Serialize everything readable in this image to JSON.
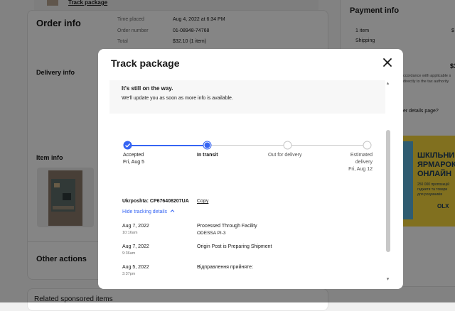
{
  "background": {
    "track_package_link": "Track package",
    "order_info": {
      "heading": "Order info",
      "rows": [
        {
          "label": "Time placed",
          "value": "Aug 4, 2022 at 6:34 PM"
        },
        {
          "label": "Order number",
          "value": "01-08948-74768"
        },
        {
          "label": "Total",
          "value": "$32.10 (1 item)"
        }
      ]
    },
    "delivery_info": "Delivery info",
    "item_info": "Item info",
    "other_actions": "Other actions",
    "related": "Related sponsored items",
    "payment_info": {
      "heading": "Payment info",
      "rows": [
        {
          "label": "1 item",
          "value": "$"
        },
        {
          "label": "Shipping",
          "value": ""
        }
      ],
      "total_fragment": "$3",
      "note_line1": "ccordance with applicable s",
      "note_line2": "directly to the tax authority",
      "question": "er details page?"
    },
    "ad": {
      "line1": "ШКІЛЬНИЙ",
      "line2": "ЯРМАРОК",
      "line3": "ОНЛАЙН",
      "small1": "250 000 пропозицій",
      "small2": "гаджети та товари",
      "small3": "для розумників",
      "brand": "OLX"
    }
  },
  "modal": {
    "title": "Track package",
    "banner_title": "It's still on the way.",
    "banner_sub": "We'll update you as soon as more info is available.",
    "steps": [
      {
        "label": "Accepted",
        "sub": "Fri, Aug 5",
        "state": "done"
      },
      {
        "label": "In transit",
        "sub": "",
        "state": "current"
      },
      {
        "label": "Out for delivery",
        "sub": "",
        "state": "pending"
      },
      {
        "label": "Estimated",
        "sub": "delivery",
        "sub2": "Fri, Aug 12",
        "state": "pending"
      }
    ],
    "carrier": "Ukrposhta:",
    "tracking_number": "CP676408207UA",
    "copy_label": "Copy",
    "hide_details": "Hide tracking details",
    "events": [
      {
        "date": "Aug 7, 2022",
        "time": "10:16am",
        "event": "Processed Through Facility",
        "location": "ODESSA PI-3"
      },
      {
        "date": "Aug 7, 2022",
        "time": "9:36am",
        "event": "Origin Post is Preparing Shipment",
        "location": ""
      },
      {
        "date": "Aug 5, 2022",
        "time": "3:37pm",
        "event": "Відправлення прийняте:",
        "location": ""
      }
    ],
    "colors": {
      "accent": "#3665f3",
      "pending": "#c7c7c7",
      "text": "#191919"
    }
  }
}
